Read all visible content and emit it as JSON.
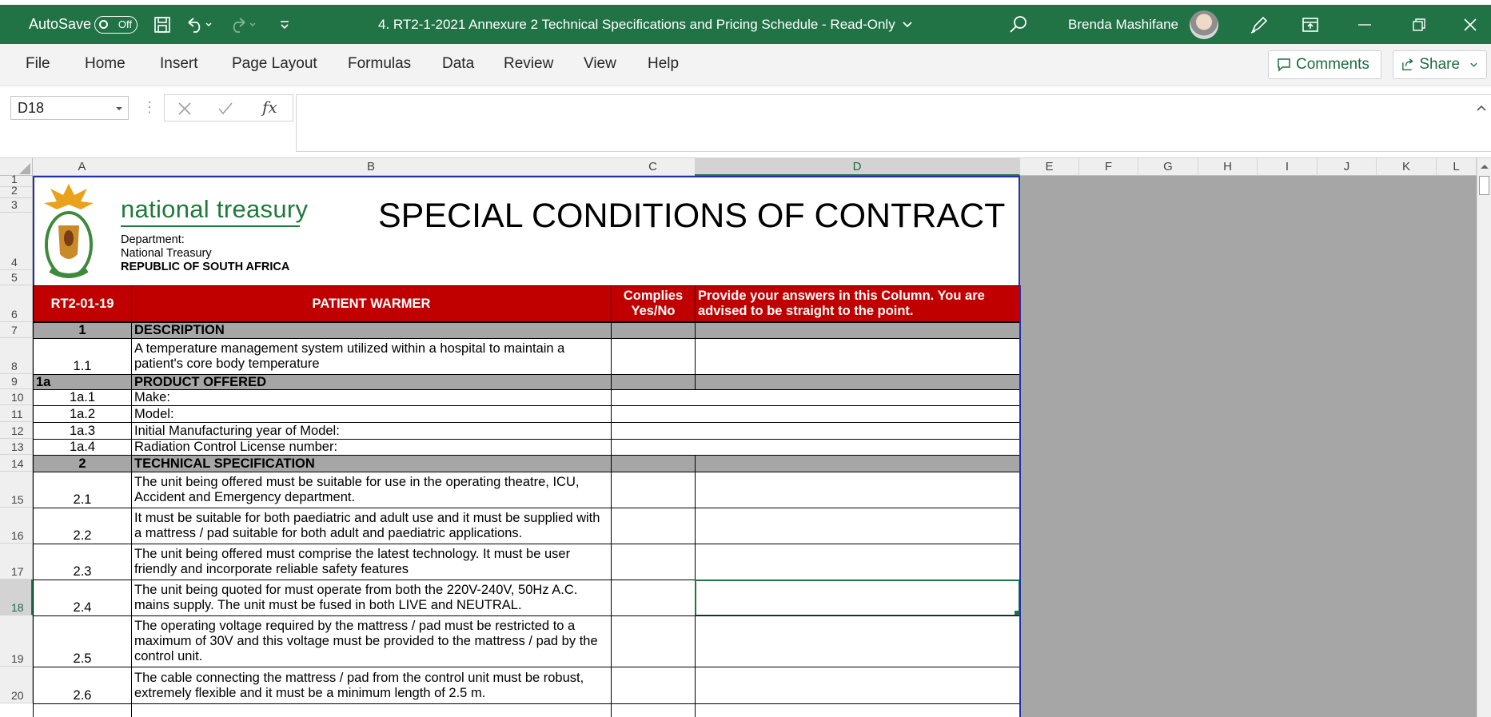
{
  "titlebar": {
    "autosave_label": "AutoSave",
    "autosave_state": "Off",
    "document_title": "4. RT2-1-2021 Annexure 2 Technical Specifications and Pricing Schedule  -  Read-Only",
    "user_name": "Brenda Mashifane",
    "icons": [
      "save-icon",
      "undo-icon",
      "redo-icon",
      "customize-qat-icon",
      "search-icon",
      "pen-icon",
      "ribbon-display-icon",
      "minimize-icon",
      "restore-icon",
      "close-icon"
    ]
  },
  "menu": {
    "items": [
      "File",
      "Home",
      "Insert",
      "Page Layout",
      "Formulas",
      "Data",
      "Review",
      "View",
      "Help"
    ],
    "comments_label": "Comments",
    "share_label": "Share"
  },
  "formula_bar": {
    "name_box": "D18",
    "fx_label": "fx",
    "value": ""
  },
  "columns": [
    "A",
    "B",
    "C",
    "D",
    "E",
    "F",
    "G",
    "H",
    "I",
    "J",
    "K",
    "L"
  ],
  "selected_cell": "D18",
  "sheet": {
    "logo_text": "national treasury",
    "logo_dept": "Department:",
    "logo_unit": "National Treasury",
    "logo_country": "REPUBLIC OF SOUTH AFRICA",
    "main_title": "SPECIAL CONDITIONS OF CONTRACT",
    "header": {
      "code": "RT2-01-19",
      "item": "PATIENT WARMER",
      "complies": "Complies Yes/No",
      "answers": "Provide your answers in this Column.  You are advised to be straight to the point."
    },
    "rows": [
      {
        "row": "7",
        "a": "1",
        "b": "DESCRIPTION",
        "style": "section"
      },
      {
        "row": "8",
        "a": "1.1",
        "b": "A temperature management system utilized within a hospital to maintain a patient's core body temperature",
        "style": "item"
      },
      {
        "row": "9",
        "a": "1a",
        "b": "PRODUCT OFFERED",
        "style": "section-left"
      },
      {
        "row": "10",
        "a": "1a.1",
        "b": "Make:",
        "style": "merged"
      },
      {
        "row": "11",
        "a": "1a.2",
        "b": "Model:",
        "style": "merged"
      },
      {
        "row": "12",
        "a": "1a.3",
        "b": "Initial Manufacturing year of Model:",
        "style": "merged"
      },
      {
        "row": "13",
        "a": "1a.4",
        "b": "Radiation Control License number:",
        "style": "merged"
      },
      {
        "row": "14",
        "a": "2",
        "b": "TECHNICAL SPECIFICATION",
        "style": "section"
      },
      {
        "row": "15",
        "a": "2.1",
        "b": "The unit being offered must be suitable for use in the operating theatre, ICU, Accident and Emergency department.",
        "style": "item"
      },
      {
        "row": "16",
        "a": "2.2",
        "b": "It must be suitable for both paediatric and adult use and it must be supplied with a mattress / pad suitable for both adult and paediatric applications.",
        "style": "item"
      },
      {
        "row": "17",
        "a": "2.3",
        "b": "The unit being offered must comprise the latest technology. It must be user friendly and incorporate reliable safety features",
        "style": "item"
      },
      {
        "row": "18",
        "a": "2.4",
        "b": "The unit being quoted for must operate from both the 220V-240V, 50Hz A.C. mains supply. The unit must be fused in both LIVE and NEUTRAL.",
        "style": "item"
      },
      {
        "row": "19",
        "a": "2.5",
        "b": "The operating voltage required by the mattress / pad must be restricted to a maximum of 30V and this voltage must be provided to the mattress / pad by the control unit.",
        "style": "item"
      },
      {
        "row": "20",
        "a": "2.6",
        "b": "The cable connecting the mattress / pad from the control unit must be robust, extremely flexible and it must be a minimum length of 2.5 m.",
        "style": "item"
      }
    ]
  }
}
